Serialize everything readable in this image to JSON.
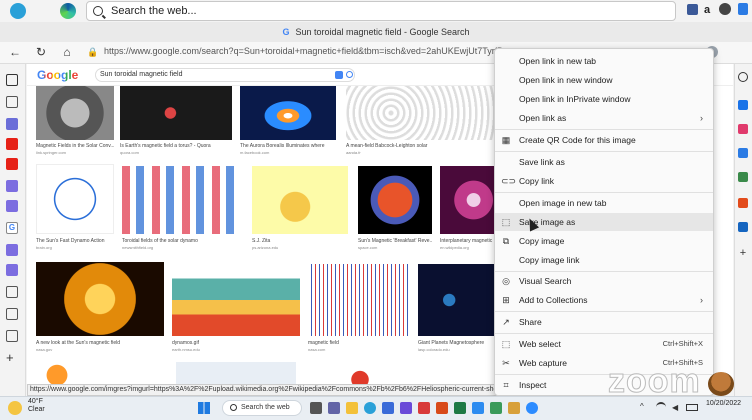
{
  "edge_top": {
    "search_placeholder": "Search the web..."
  },
  "titlebar": {
    "title": "Sun toroidal magnetic field - Google Search"
  },
  "address_bar": {
    "url": "https://www.google.com/search?q=Sun+toroidal+magnetic+field&tbm=isch&ved=2ahUKEwjUt7TyrfD6"
  },
  "google": {
    "logo": "Google",
    "query": "Sun toroidal magnetic field"
  },
  "results": [
    {
      "caption": "Magnetic Fields in the Solar Conv...",
      "source": "link.springer.com"
    },
    {
      "caption": "Is Earth's magnetic field a torus? - Quora",
      "source": "quora.com"
    },
    {
      "caption": "The Aurora Borealis Illuminates where",
      "source": "m.facebook.com"
    },
    {
      "caption": "A mean-field Babcock-Leighton solar",
      "source": "aanda.fr"
    },
    {
      "caption": "The Sun's Fast Dynamo Action",
      "source": "brain.org"
    },
    {
      "caption": "Toroidal fields of the solar dynamo",
      "source": "newsmithfield.org"
    },
    {
      "caption": "S.J. Zita",
      "source": "ps.arizona.edu"
    },
    {
      "caption": "Sun's Magnetic 'Breakfast' Reve...",
      "source": "space.com"
    },
    {
      "caption": "Interplanetary magnetic",
      "source": "en.wikipedia.org"
    },
    {
      "caption": "A new look at the Sun's magnetic field",
      "source": "nasa.gov"
    },
    {
      "caption": "dynamos.gif",
      "source": "earth.nmsu.edu"
    },
    {
      "caption": "magnetic field",
      "source": "nasa.com"
    },
    {
      "caption": "Giant Planets Magnetosphere",
      "source": "lasp.colorado.edu"
    }
  ],
  "status_url": "https://www.google.com/imgres?imgurl=https%3A%2F%2Fupload.wikimedia.org%2Fwikipedia%2Fcommons%2Fb%2Fb6%2FHeliospheric-current-sheet.gif",
  "context_menu": {
    "items": [
      {
        "label": "Open link in new tab"
      },
      {
        "label": "Open link in new window"
      },
      {
        "label": "Open link in InPrivate window"
      },
      {
        "label": "Open link as"
      },
      {
        "label": "Create QR Code for this image"
      },
      {
        "label": "Save link as"
      },
      {
        "label": "Copy link"
      },
      {
        "label": "Open image in new tab"
      },
      {
        "label": "Save image as"
      },
      {
        "label": "Copy image"
      },
      {
        "label": "Copy image link"
      },
      {
        "label": "Visual Search"
      },
      {
        "label": "Add to Collections"
      },
      {
        "label": "Share"
      },
      {
        "label": "Web select",
        "shortcut": "Ctrl+Shift+X"
      },
      {
        "label": "Web capture",
        "shortcut": "Ctrl+Shift+S"
      },
      {
        "label": "Inspect"
      }
    ],
    "highlighted_item": "Save image as"
  },
  "watermark": "zoom",
  "taskbar": {
    "temperature": "40°F",
    "condition": "Clear",
    "search_label": "Search the web",
    "date": "10/20/2022"
  }
}
